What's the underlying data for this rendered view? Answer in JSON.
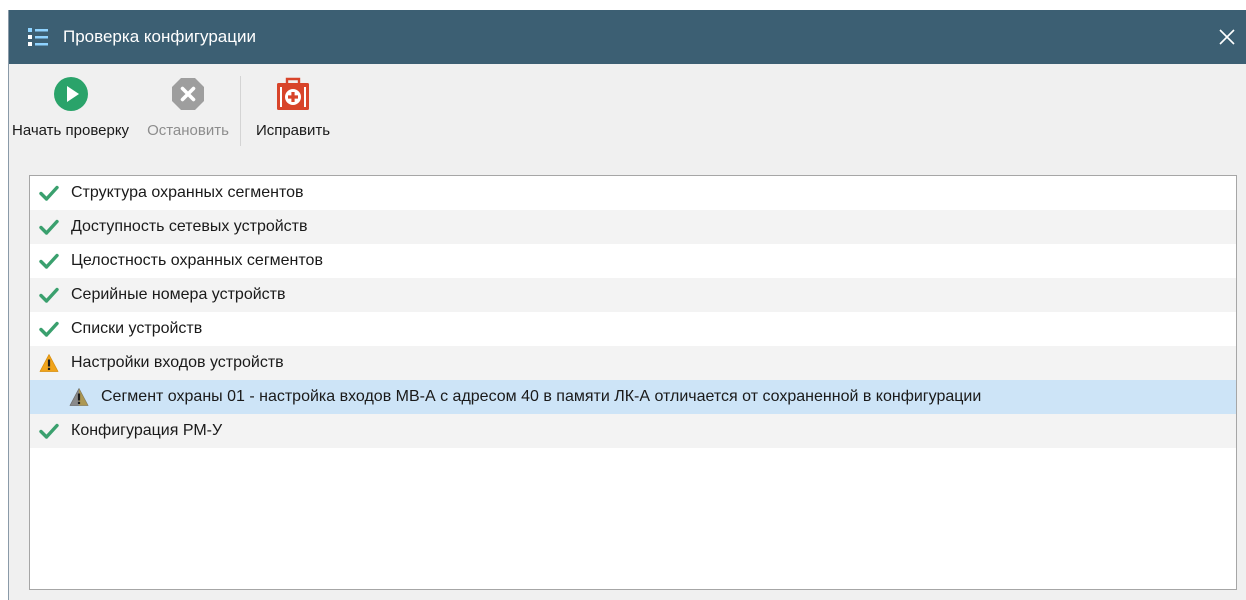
{
  "window": {
    "title": "Проверка конфигурации",
    "close_symbol": "✕",
    "title_color": "#3c5f73"
  },
  "toolbar": {
    "start_label": "Начать проверку",
    "stop_label": "Остановить",
    "fix_label": "Исправить",
    "start_icon": "play-circle-icon",
    "stop_icon": "stop-x-icon",
    "fix_icon": "first-aid-kit-icon"
  },
  "checks": [
    {
      "label": "Структура охранных сегментов",
      "status": "ok"
    },
    {
      "label": "Доступность сетевых устройств",
      "status": "ok"
    },
    {
      "label": "Целостность охранных сегментов",
      "status": "ok"
    },
    {
      "label": "Серийные номера устройств",
      "status": "ok"
    },
    {
      "label": "Списки устройств",
      "status": "ok"
    },
    {
      "label": "Настройки входов устройств",
      "status": "warning"
    },
    {
      "label": "Сегмент охраны 01 - настройка входов МВ-А с адресом 40 в памяти ЛК-А отличается от сохраненной в конфигурации",
      "status": "detail-warning",
      "selected": true
    },
    {
      "label": "Конфигурация РМ-У",
      "status": "ok"
    }
  ],
  "colors": {
    "ok": "#3aa06e",
    "warning": "#f0a31a",
    "start": "#2aa36a",
    "stop": "#9e9e9e",
    "fix": "#d8442a",
    "selection": "#cde4f7"
  }
}
